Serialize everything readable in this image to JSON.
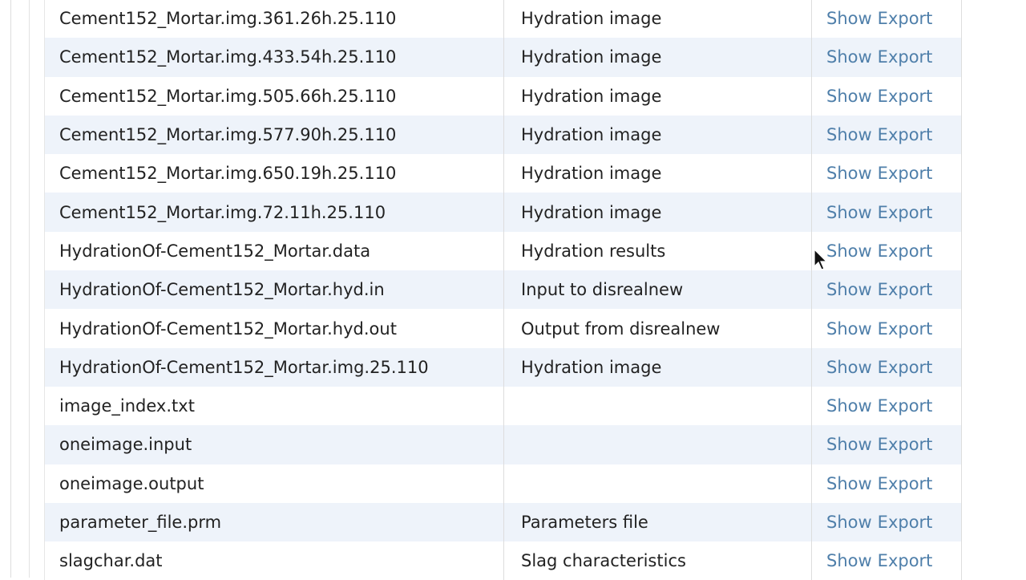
{
  "rows": [
    {
      "file": "Cement152_Mortar.img.361.26h.25.110",
      "desc": "Hydration image",
      "show": "Show",
      "export": "Export"
    },
    {
      "file": "Cement152_Mortar.img.433.54h.25.110",
      "desc": "Hydration image",
      "show": "Show",
      "export": "Export"
    },
    {
      "file": "Cement152_Mortar.img.505.66h.25.110",
      "desc": "Hydration image",
      "show": "Show",
      "export": "Export"
    },
    {
      "file": "Cement152_Mortar.img.577.90h.25.110",
      "desc": "Hydration image",
      "show": "Show",
      "export": "Export"
    },
    {
      "file": "Cement152_Mortar.img.650.19h.25.110",
      "desc": "Hydration image",
      "show": "Show",
      "export": "Export"
    },
    {
      "file": "Cement152_Mortar.img.72.11h.25.110",
      "desc": "Hydration image",
      "show": "Show",
      "export": "Export"
    },
    {
      "file": "HydrationOf-Cement152_Mortar.data",
      "desc": "Hydration results",
      "show": "Show",
      "export": "Export"
    },
    {
      "file": "HydrationOf-Cement152_Mortar.hyd.in",
      "desc": "Input to disrealnew",
      "show": "Show",
      "export": "Export"
    },
    {
      "file": "HydrationOf-Cement152_Mortar.hyd.out",
      "desc": "Output from disrealnew",
      "show": "Show",
      "export": "Export"
    },
    {
      "file": "HydrationOf-Cement152_Mortar.img.25.110",
      "desc": "Hydration image",
      "show": "Show",
      "export": "Export"
    },
    {
      "file": "image_index.txt",
      "desc": "",
      "show": "Show",
      "export": "Export"
    },
    {
      "file": "oneimage.input",
      "desc": "",
      "show": "Show",
      "export": "Export"
    },
    {
      "file": "oneimage.output",
      "desc": "",
      "show": "Show",
      "export": "Export"
    },
    {
      "file": "parameter_file.prm",
      "desc": "Parameters file",
      "show": "Show",
      "export": "Export"
    },
    {
      "file": "slagchar.dat",
      "desc": "Slag characteristics",
      "show": "Show",
      "export": "Export"
    }
  ],
  "colors": {
    "link": "#4f7faa",
    "alt_row": "#eef3fa"
  },
  "cursor_icon": "arrow-pointer"
}
